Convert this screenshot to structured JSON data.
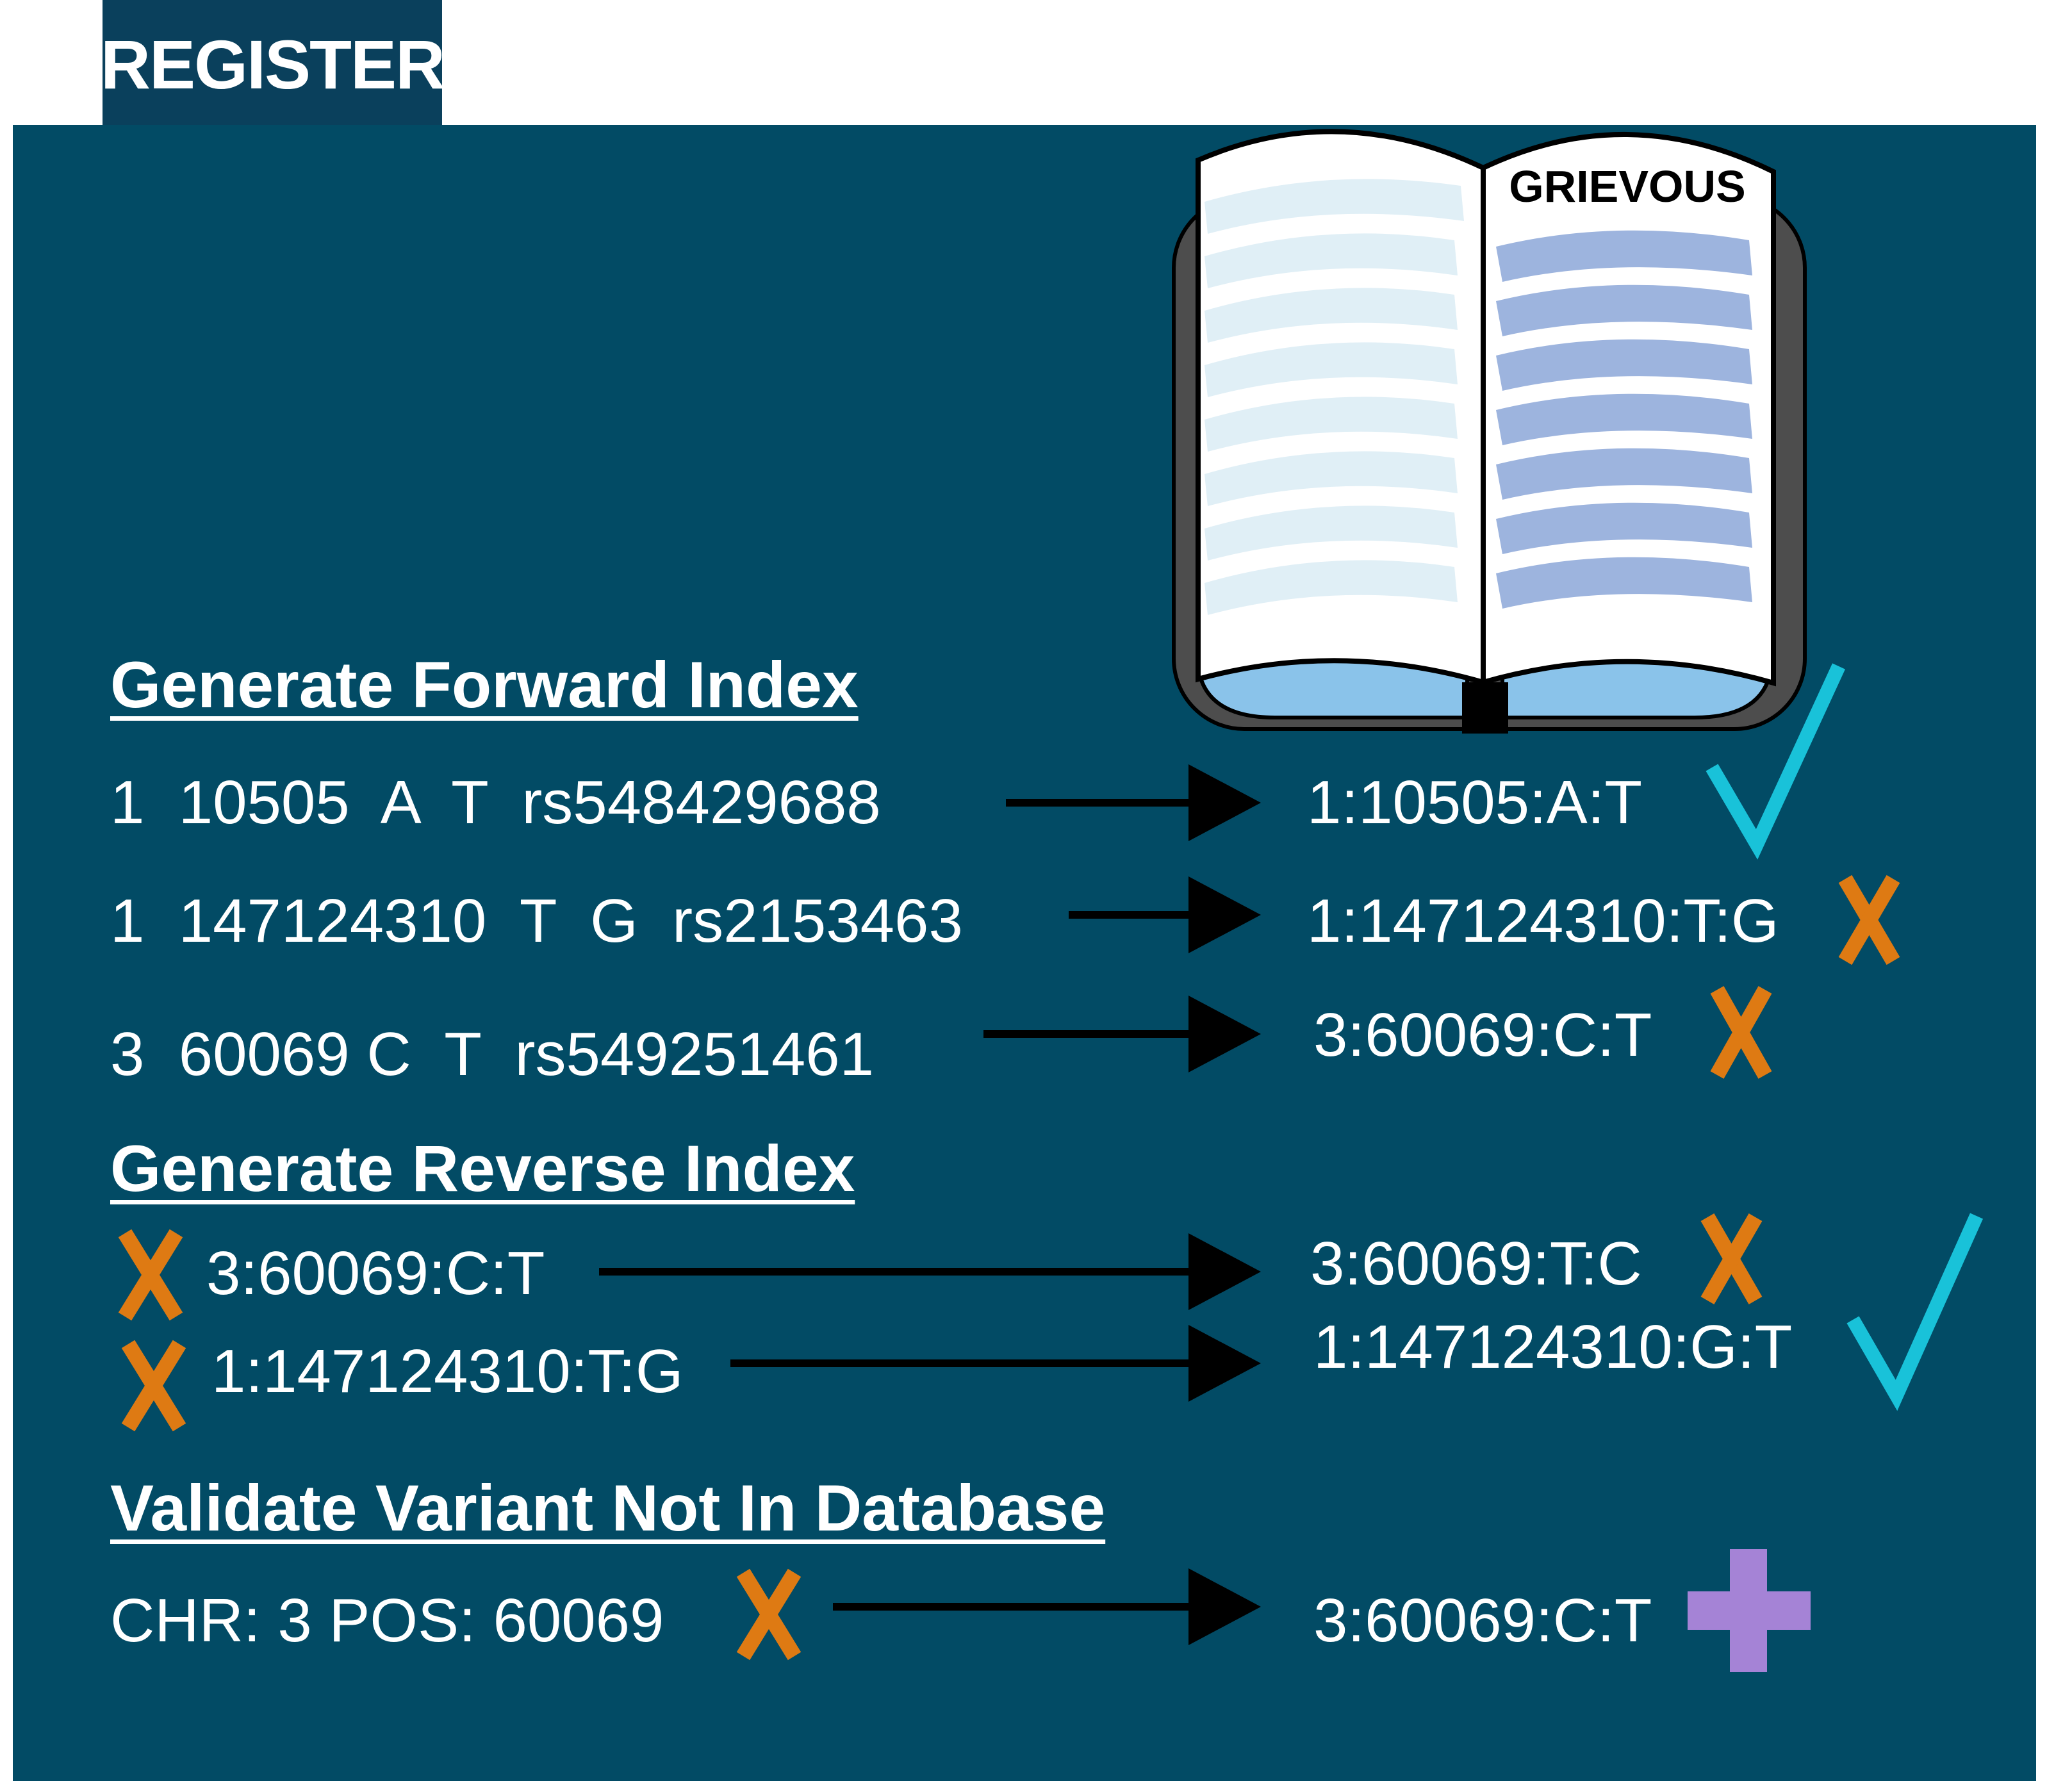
{
  "tab_label": "REGISTER",
  "book_title": "GRIEVOUS",
  "colors": {
    "panel": "#024b65",
    "tab": "#0a405c",
    "check": "#19c2d9",
    "cross": "#de7a13",
    "plus": "#a583d6",
    "arrow": "#000000"
  },
  "forward": {
    "heading": "Generate Forward Index",
    "rows": [
      {
        "input": "1  10505  A  T  rs548429688",
        "output": "1:10505:A:T",
        "status": "check"
      },
      {
        "input": "1  147124310  T  G  rs2153463",
        "output": "1:147124310:T:G",
        "status": "cross"
      },
      {
        "input": "3  60069 C  T  rs549251461",
        "output": "3:60069:C:T",
        "status": "cross"
      }
    ]
  },
  "reverse": {
    "heading": "Generate Reverse Index",
    "rows": [
      {
        "input": "3:60069:C:T",
        "input_status": "cross",
        "output": "3:60069:T:C",
        "status": "cross"
      },
      {
        "input": "1:147124310:T:G",
        "input_status": "cross",
        "output": "1:147124310:G:T",
        "status": "check"
      }
    ]
  },
  "validate": {
    "heading": "Validate Variant Not In Database",
    "rows": [
      {
        "input": "CHR: 3 POS: 60069",
        "input_status": "cross",
        "output": "3:60069:C:T",
        "status": "plus"
      }
    ]
  }
}
